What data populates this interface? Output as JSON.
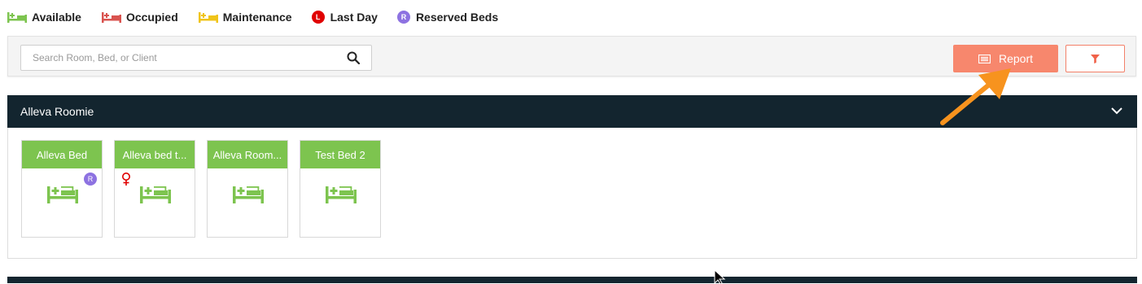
{
  "legend": {
    "available": "Available",
    "occupied": "Occupied",
    "maintenance": "Maintenance",
    "last_day": "Last Day",
    "last_day_badge": "L",
    "reserved": "Reserved Beds",
    "reserved_badge": "R"
  },
  "colors": {
    "available": "#7dc44f",
    "occupied": "#d9534f",
    "maintenance": "#f0c419",
    "last_day": "#e00000",
    "reserved": "#8d72e1",
    "header_bg": "#13252f",
    "report_btn": "#f7876d"
  },
  "toolbar": {
    "search_placeholder": "Search Room, Bed, or Client",
    "report_label": "Report"
  },
  "room": {
    "name": "Alleva Roomie",
    "beds": [
      {
        "name": "Alleva Bed",
        "badge": "R",
        "status": "available"
      },
      {
        "name": "Alleva bed t...",
        "status": "available",
        "indicator": "female-icon"
      },
      {
        "name": "Alleva Room...",
        "status": "available"
      },
      {
        "name": "Test Bed 2",
        "status": "available"
      }
    ]
  }
}
